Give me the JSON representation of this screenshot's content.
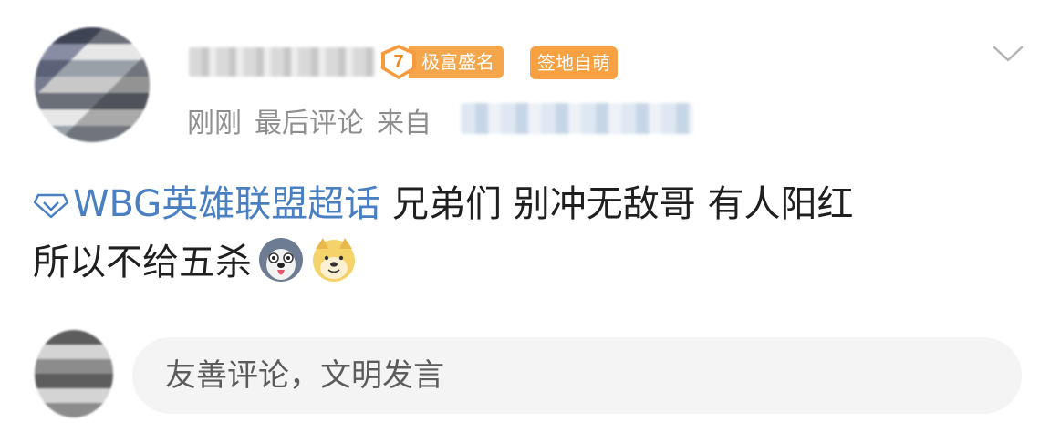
{
  "post": {
    "level": "7",
    "level_title": "极富盛名",
    "tag": "签地自萌",
    "time": "刚刚",
    "last_comment": "最后评论",
    "source_prefix": "来自",
    "topic": "WBG英雄联盟超话",
    "text_line1": " 兄弟们 别冲无敌哥 有人阳红",
    "text_line2": "所以不给五杀",
    "emojis": [
      "husky-emoji",
      "doge-emoji"
    ]
  },
  "comment_box": {
    "placeholder": "友善评论，文明发言"
  },
  "colors": {
    "link": "#4a7fc1",
    "badge_orange": "#f7a142",
    "meta_gray": "#8e8e8e",
    "input_bg": "#f4f4f4"
  }
}
